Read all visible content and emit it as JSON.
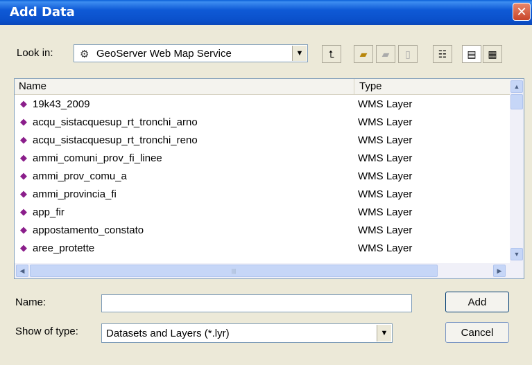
{
  "window": {
    "title": "Add Data"
  },
  "toolbar": {
    "look_in_label": "Look in:",
    "look_in_value": "GeoServer Web Map Service",
    "look_in_icon": "server-icon"
  },
  "list": {
    "columns": [
      "Name",
      "Type"
    ],
    "rows": [
      {
        "name": "19k43_2009",
        "type": "WMS Layer"
      },
      {
        "name": "acqu_sistacquesup_rt_tronchi_arno",
        "type": "WMS Layer"
      },
      {
        "name": "acqu_sistacquesup_rt_tronchi_reno",
        "type": "WMS Layer"
      },
      {
        "name": "ammi_comuni_prov_fi_linee",
        "type": "WMS Layer"
      },
      {
        "name": "ammi_prov_comu_a",
        "type": "WMS Layer"
      },
      {
        "name": "ammi_provincia_fi",
        "type": "WMS Layer"
      },
      {
        "name": "app_fir",
        "type": "WMS Layer"
      },
      {
        "name": "appostamento_constato",
        "type": "WMS Layer"
      },
      {
        "name": "aree_protette",
        "type": "WMS Layer"
      }
    ],
    "row_icon": "wms-layer-icon",
    "icon_color": "#8B1E8B"
  },
  "form": {
    "name_label": "Name:",
    "name_value": "",
    "type_label": "Show of type:",
    "type_value": "Datasets and Layers (*.lyr)"
  },
  "buttons": {
    "add": "Add",
    "cancel": "Cancel"
  },
  "colors": {
    "title_bar": "#0A4FC9",
    "dialog_bg": "#ECE9D8",
    "close_button": "#C8452A"
  }
}
